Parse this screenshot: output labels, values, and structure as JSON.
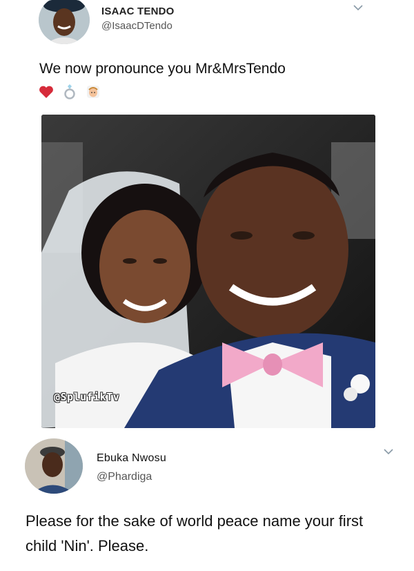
{
  "tweet": {
    "author_name": "ISAAC TENDO",
    "author_handle": "@IsaacDTendo",
    "text": "We now pronounce you Mr&MrsTendo",
    "emojis": [
      "red-heart",
      "ring",
      "bride-with-veil"
    ],
    "photo": {
      "watermark": "@SplufikTv"
    }
  },
  "reply": {
    "author_name": "Ebuka Nwosu",
    "author_handle": "@Phardiga",
    "text": "Please for the sake of world peace name your first child 'Nin'. Please."
  },
  "colors": {
    "heart": "#d62b3a",
    "bow_tie": "#f2a9c9",
    "suit": "#243a73",
    "handle_gray": "#555555"
  }
}
